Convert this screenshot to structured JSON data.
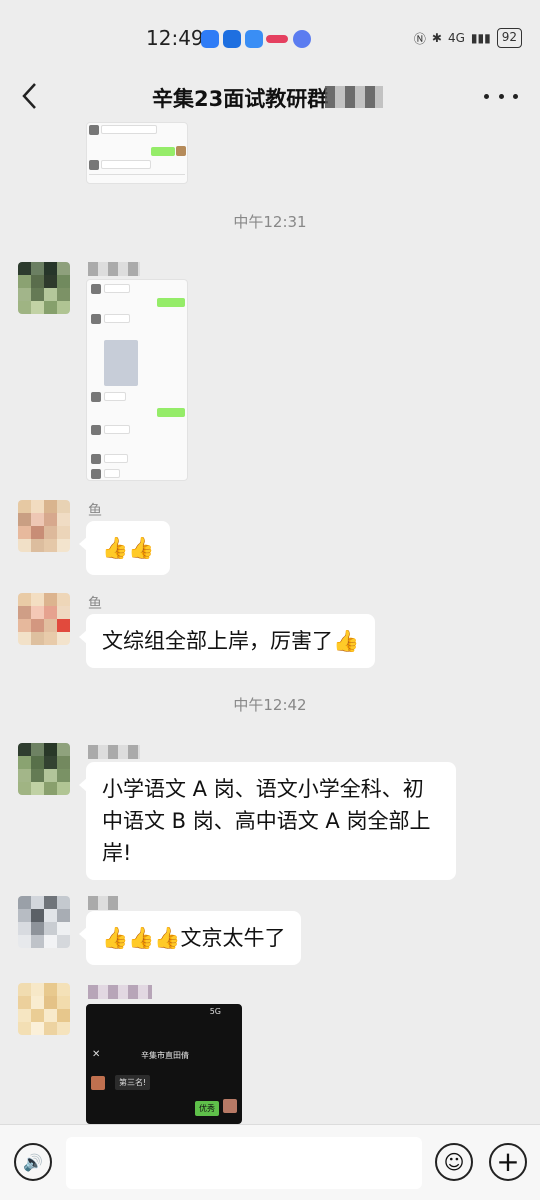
{
  "status": {
    "time": "12:49",
    "network": "4G",
    "battery": "92"
  },
  "header": {
    "title": "辛集23面试教研群"
  },
  "timestamps": [
    "中午12:31",
    "中午12:42"
  ],
  "messages": [
    {
      "sender": "鱼",
      "text": "👍👍"
    },
    {
      "sender": "鱼",
      "text": "文综组全部上岸，厉害了👍"
    },
    {
      "sender": "",
      "text": "小学语文 A 岗、语文小学全科、初中语文 B 岗、高中语文 A 岗全部上岸!"
    },
    {
      "sender": "",
      "text": "👍👍👍文京太牛了"
    }
  ],
  "screenshot_thumbs": {
    "first": {
      "lines": [
        "旨在学习",
        "提全考生 生给 🙂🙂🙂"
      ]
    },
    "second": {
      "rows": [
        "好老师!",
        "怎么得啊",
        "金组示一",
        "我是20",
        "恭喜恭喜",
        "哈哈哈哈",
        "过程过程",
        "第二"
      ]
    },
    "third": {
      "chat_title": "辛集市直田倩",
      "msg_left": "第三名!",
      "msg_right": "优秀",
      "signal": "5G"
    }
  },
  "colors": {
    "background": "#ededed",
    "bubble": "#ffffff",
    "self_bubble": "#95ec69"
  }
}
